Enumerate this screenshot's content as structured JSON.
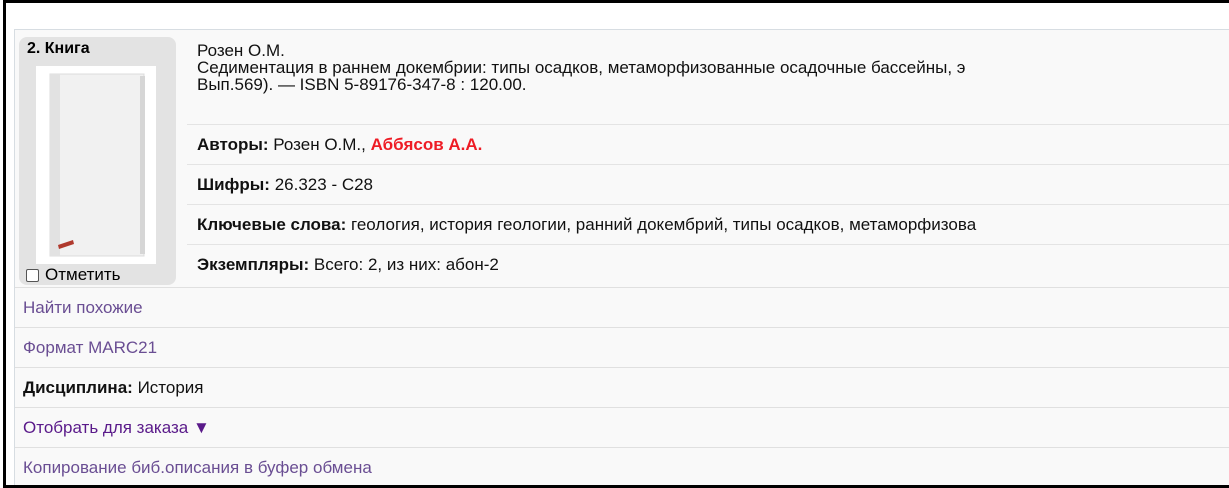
{
  "record": {
    "number_label": "2. Книга",
    "mark_label": "Отметить",
    "description": {
      "line1": "Розен О.М.",
      "line2": "Седиментация в раннем докембрии: типы осадков, метаморфизованные осадочные бассейны, э",
      "line3": "Вып.569). — ISBN 5-89176-347-8 : 120.00."
    },
    "authors": {
      "label": "Авторы:",
      "primary": "Розен О.М.,",
      "highlighted": "Аббясов А.А."
    },
    "codes": {
      "label": "Шифры:",
      "value": "26.323 - С28"
    },
    "keywords": {
      "label": "Ключевые слова:",
      "value": "геология, история геологии, ранний докембрий, типы осадков, метаморфизова"
    },
    "copies": {
      "label": "Экземпляры:",
      "value": "Всего: 2, из них: абон-2"
    }
  },
  "actions": {
    "find_similar": "Найти похожие",
    "marc_format": "Формат MARC21",
    "discipline_label": "Дисциплина:",
    "discipline_value": "История",
    "order_select": "Отобрать для заказа",
    "order_arrow": "▼",
    "copy_description": "Копирование биб.описания в буфер обмена"
  },
  "colors": {
    "author_highlight": "#ee1c25",
    "link": "#6a4e93",
    "order_link": "#5a1a8a"
  },
  "icons": {
    "cover": "book-cover-icon",
    "dropdown": "triangle-down-icon"
  }
}
